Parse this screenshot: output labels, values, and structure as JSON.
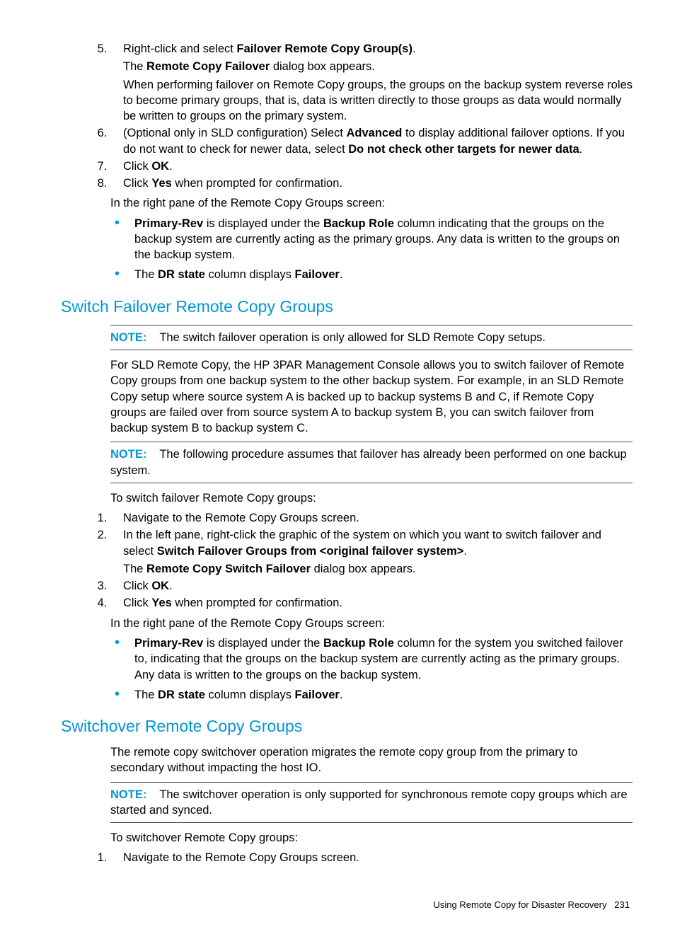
{
  "top_steps": {
    "s5a": "Right-click and select ",
    "s5b": "Failover Remote Copy Group(s)",
    "s5c": ".",
    "s5d1": "The ",
    "s5d2": "Remote Copy Failover",
    "s5d3": " dialog box appears.",
    "s5e": "When performing failover on Remote Copy groups, the groups on the backup system reverse roles to become primary groups, that is, data is written directly to those groups as data would normally be written to groups on the primary system.",
    "s6a": "(Optional only in SLD configuration) Select ",
    "s6b": "Advanced",
    "s6c": " to display additional failover options. If you do not want to check for newer data, select ",
    "s6d": "Do not check other targets for newer data",
    "s6e": ".",
    "s7a": "Click ",
    "s7b": "OK",
    "s7c": ".",
    "s8a": "Click ",
    "s8b": "Yes",
    "s8c": " when prompted for confirmation."
  },
  "top_after": "In the right pane of the Remote Copy Groups screen:",
  "top_bullets": {
    "b1a": "Primary-Rev",
    "b1b": " is displayed under the ",
    "b1c": "Backup Role",
    "b1d": " column indicating that the groups on the backup system are currently acting as the primary groups. Any data is written to the groups on the backup system.",
    "b2a": "The ",
    "b2b": "DR state",
    "b2c": " column displays ",
    "b2d": "Failover",
    "b2e": "."
  },
  "switch": {
    "heading": "Switch Failover Remote Copy Groups",
    "note1_label": "NOTE:",
    "note1_text": "The switch failover operation is only allowed for SLD Remote Copy setups.",
    "intro": "For SLD Remote Copy, the HP 3PAR Management Console allows you to switch failover of Remote Copy groups from one backup system to the other backup system. For example, in an SLD Remote Copy setup where source system A is backed up to backup systems B and C, if Remote Copy groups are failed over from source system A to backup system B, you can switch failover from backup system B to backup system C.",
    "note2_label": "NOTE:",
    "note2_text": "The following procedure assumes that failover has already been performed on one backup system.",
    "lead": "To switch failover Remote Copy groups:",
    "s1": "Navigate to the Remote Copy Groups screen.",
    "s2a": "In the left pane, right-click the graphic of the system on which you want to switch failover and select ",
    "s2b": "Switch Failover Groups from <original failover system>",
    "s2c": ".",
    "s2d1": "The ",
    "s2d2": "Remote Copy Switch Failover",
    "s2d3": " dialog box appears.",
    "s3a": "Click ",
    "s3b": "OK",
    "s3c": ".",
    "s4a": "Click ",
    "s4b": "Yes",
    "s4c": " when prompted for confirmation.",
    "after": "In the right pane of the Remote Copy Groups screen:",
    "b1a": "Primary-Rev",
    "b1b": " is displayed under the ",
    "b1c": "Backup Role",
    "b1d": " column for the system you switched failover to, indicating that the groups on the backup system are currently acting as the primary groups. Any data is written to the groups on the backup system.",
    "b2a": "The ",
    "b2b": "DR state",
    "b2c": " column displays ",
    "b2d": "Failover",
    "b2e": "."
  },
  "switchover": {
    "heading": "Switchover Remote Copy Groups",
    "intro": "The remote copy switchover operation migrates the remote copy group from the primary to secondary without impacting the host IO.",
    "note_label": "NOTE:",
    "note_text": "The switchover operation is only supported for synchronous remote copy groups which are started and synced.",
    "lead": "To switchover Remote Copy groups:",
    "s1": "Navigate to the Remote Copy Groups screen."
  },
  "footer": {
    "text": "Using Remote Copy for Disaster Recovery",
    "page": "231"
  }
}
